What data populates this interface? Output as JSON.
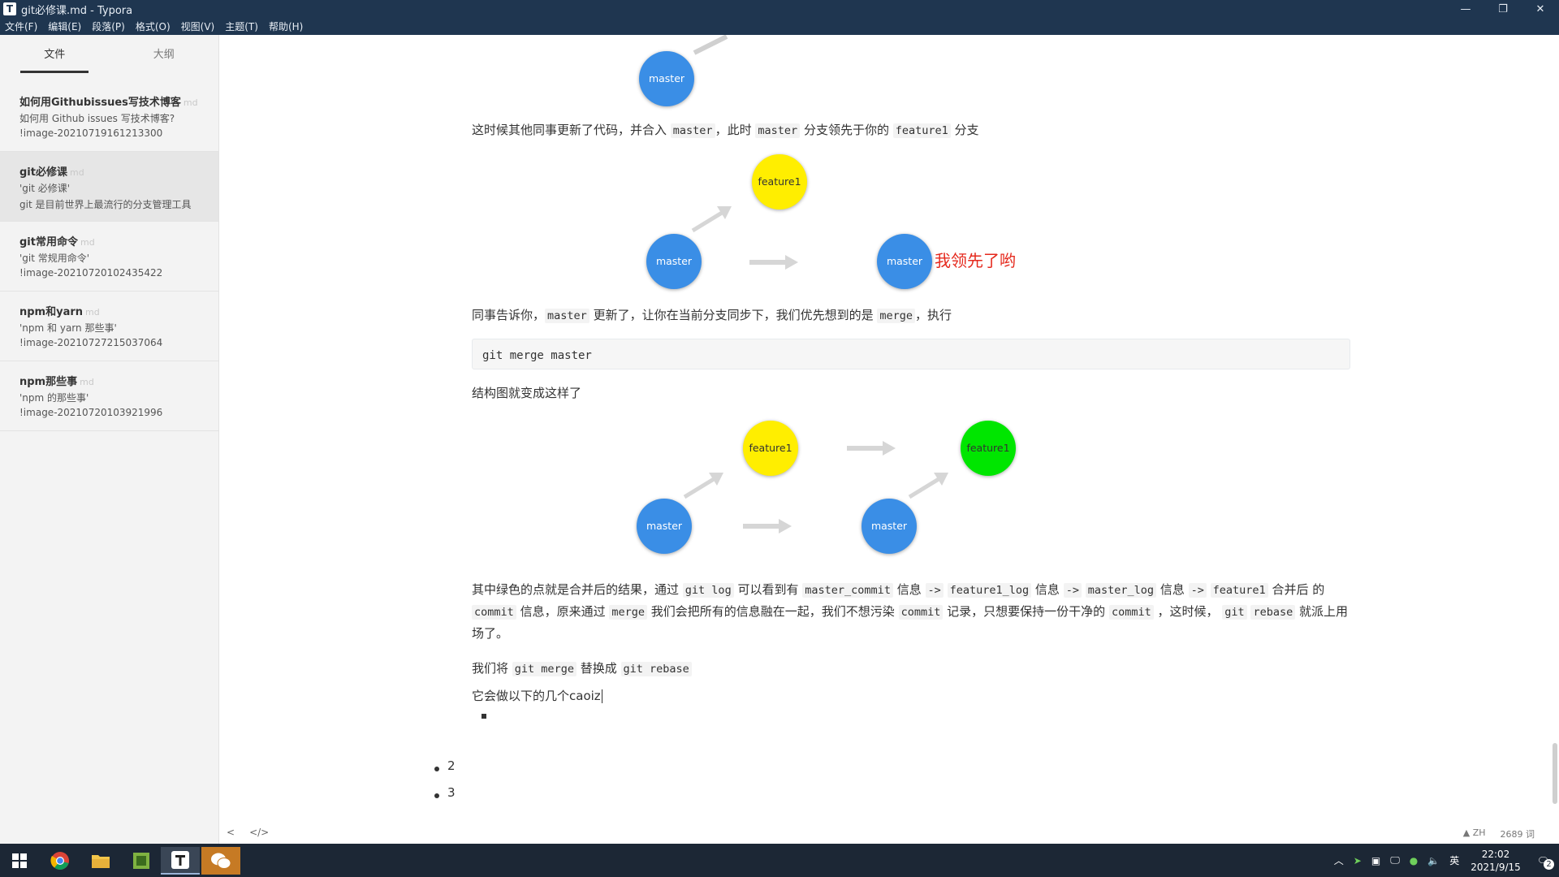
{
  "window": {
    "title": "git必修课.md - Typora",
    "app_icon": "T",
    "min": "—",
    "max": "❐",
    "close": "✕"
  },
  "menu": [
    "文件(F)",
    "编辑(E)",
    "段落(P)",
    "格式(O)",
    "视图(V)",
    "主题(T)",
    "帮助(H)"
  ],
  "sidebar": {
    "tabs": {
      "files": "文件",
      "outline": "大纲"
    },
    "files": [
      {
        "title": "如何用Githubissues写技术博客",
        "ext": "md",
        "line1": "如何用 Github issues 写技术博客?",
        "line2": "!image-20210719161213300"
      },
      {
        "title": "git必修课",
        "ext": "md",
        "line1": "'git 必修课'",
        "line2": "git 是目前世界上最流行的分支管理工具"
      },
      {
        "title": "git常用命令",
        "ext": "md",
        "line1": "'git 常规用命令'",
        "line2": "!image-20210720102435422"
      },
      {
        "title": "npm和yarn",
        "ext": "md",
        "line1": "'npm 和 yarn 那些事'",
        "line2": "!image-20210727215037064"
      },
      {
        "title": "npm那些事",
        "ext": "md",
        "line1": "'npm 的那些事'",
        "line2": "!image-20210720103921996"
      }
    ]
  },
  "doc": {
    "node_master": "master",
    "node_feature": "feature1",
    "p1": {
      "a": "这时候其他同事更新了代码，并合入",
      "c1": "master",
      "b": "，此时",
      "c2": "master",
      "d": "分支领先于你的",
      "c3": "feature1",
      "e": "分支"
    },
    "lead_text": "我领先了哟",
    "p2": {
      "a": "同事告诉你，",
      "c1": "master",
      "b": "更新了，让你在当前分支同步下，我们优先想到的是",
      "c2": "merge",
      "d": "，执行"
    },
    "codeblock": "git merge master",
    "p3": "结构图就变成这样了",
    "p4": {
      "a": "其中绿色的点就是合并后的结果，通过",
      "c1": "git log",
      "b": "可以看到有",
      "c2": "master_commit",
      "d": "信息",
      "c3": "->",
      "e": "feature1_log",
      "f": "信息",
      "c4": "->",
      "g": "master_log",
      "h": "信息",
      "c5": "->",
      "i": "feature1",
      "j": "合并后",
      "k": "的",
      "c6": "commit",
      "l": "信息，原来通过",
      "c7": "merge",
      "m": "我们会把所有的信息融在一起，我们不想污染",
      "c8": "commit",
      "n": "记录，只想要保持一份干净的",
      "c9": "commit",
      "o": "，这时候，",
      "c10": "git",
      "c11": "rebase",
      "p": "就派上用场了。"
    },
    "p5": {
      "a": "我们将",
      "c1": "git merge",
      "b": "替换成",
      "c2": "git rebase"
    },
    "p6": "它会做以下的几个caoiz",
    "list": [
      "2",
      "3"
    ]
  },
  "status": {
    "back": "<",
    "source": "</>",
    "lang": "ZH",
    "words": "2689 词"
  },
  "taskbar": {
    "time": "22:02",
    "date": "2021/9/15",
    "ime": "英",
    "notif_count": "2"
  },
  "colors": {
    "master": "#3a8ee6",
    "feature": "#ffee00",
    "merged": "#00e600",
    "lead": "#e5291d",
    "titlebar": "#1f3650"
  }
}
